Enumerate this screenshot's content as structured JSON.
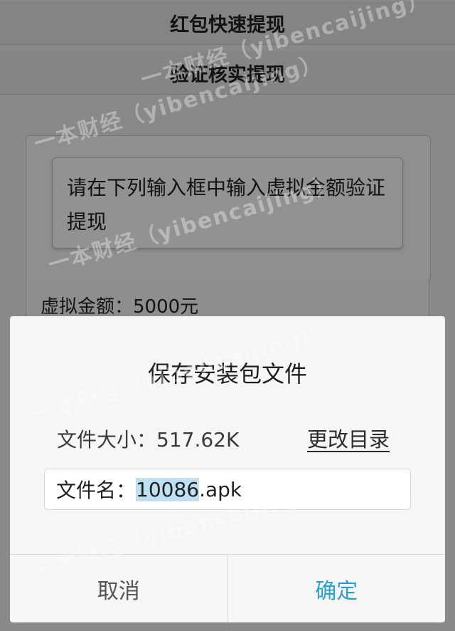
{
  "header": {
    "title1": "红包快速提现",
    "title2": "验证核实提现"
  },
  "notice": {
    "text": "请在下列输入框中输入虚拟金额验证提现"
  },
  "amount": {
    "label": "虚拟金额：",
    "value": "5000元"
  },
  "dialog": {
    "title": "保存安装包文件",
    "file_size_label": "文件大小：",
    "file_size_value": "517.62K",
    "change_dir": "更改目录",
    "filename_label": "文件名：",
    "filename_selected": "10086",
    "filename_ext": ".apk",
    "cancel": "取消",
    "confirm": "确定"
  },
  "watermark": {
    "text": "一本财经（yibencaijing）"
  },
  "colors": {
    "confirm": "#2aa1c9",
    "selection": "#bfe0f2"
  }
}
